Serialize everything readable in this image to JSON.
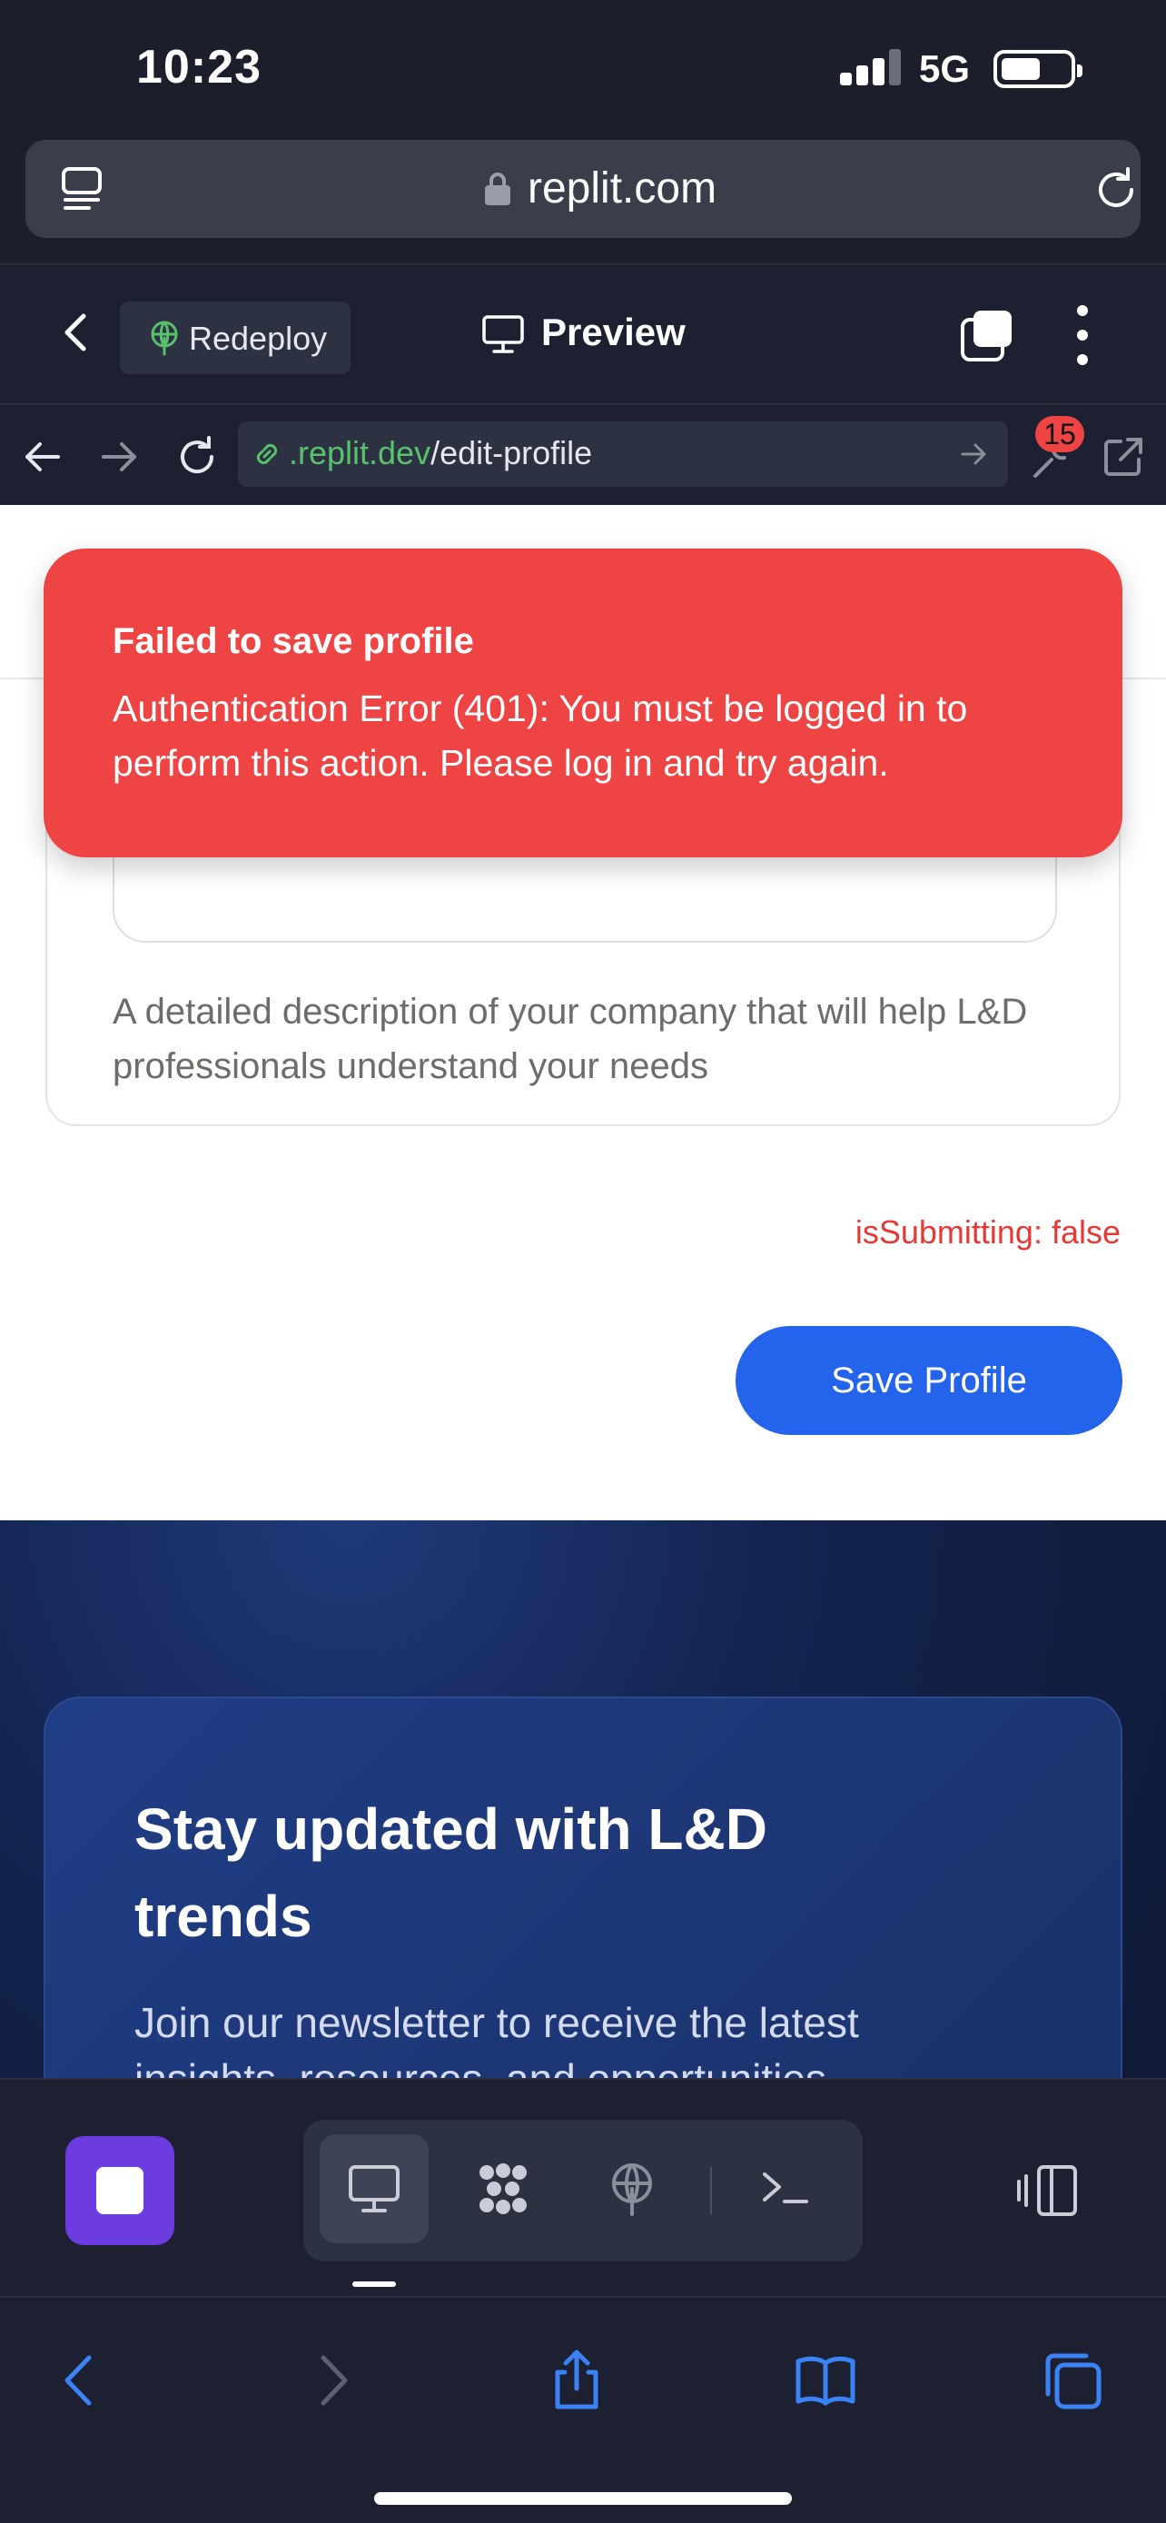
{
  "status_bar": {
    "time": "10:23",
    "network": "5G"
  },
  "browser": {
    "domain": "replit.com"
  },
  "replit_toolbar": {
    "redeploy_label": "Redeploy",
    "preview_label": "Preview"
  },
  "webview": {
    "url_host": ".replit.dev",
    "url_path": "/edit-profile",
    "devtools_badge": "15"
  },
  "toast": {
    "title": "Failed to save profile",
    "message": "Authentication Error (401): You must be logged in to perform this action. Please log in and try again."
  },
  "form": {
    "description_help": "A detailed description of your company that will help L&D professionals understand your needs",
    "debug_status": "isSubmitting: false",
    "save_button": "Save Profile"
  },
  "newsletter": {
    "title": "Stay updated with L&D trends",
    "text": "Join our newsletter to receive the latest insights, resources, and opportunities"
  },
  "colors": {
    "toast_bg": "#ef4444",
    "primary_button": "#2463eb",
    "debug_text": "#e53935",
    "url_host": "#58c16c",
    "stop_button": "#6c3ce0"
  }
}
